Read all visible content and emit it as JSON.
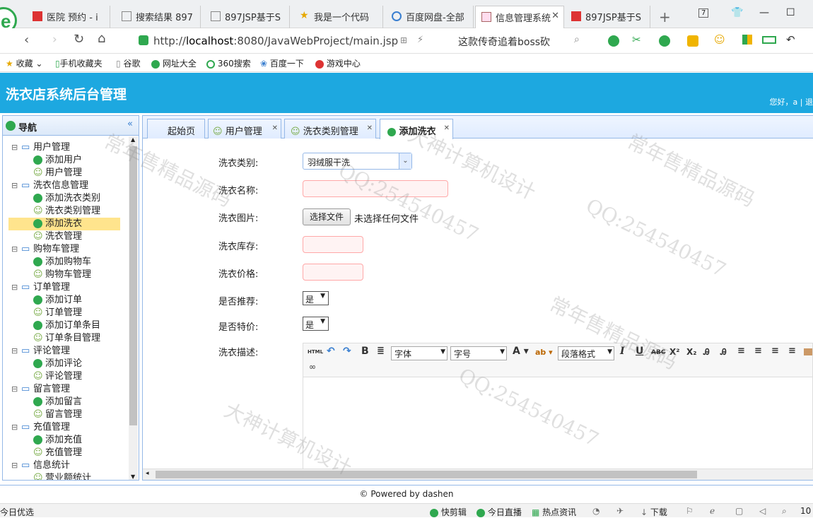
{
  "browser": {
    "tabs": [
      {
        "label": "医院 预约 - i"
      },
      {
        "label": "搜索结果 897"
      },
      {
        "label": "897JSP基于S"
      },
      {
        "label": "我是一个代码"
      },
      {
        "label": "百度网盘-全部"
      },
      {
        "label": "信息管理系统"
      },
      {
        "label": "897JSP基于S"
      }
    ],
    "tab_count": "7",
    "url_prefix": "http://",
    "url_host": "localhost",
    "url_rest": ":8080/JavaWebProject/main.jsp",
    "search_text": "这款传奇追着boss砍",
    "bookmarks": [
      "收藏",
      "手机收藏夹",
      "谷歌",
      "网址大全",
      "360搜索",
      "百度一下",
      "游戏中心"
    ]
  },
  "header": {
    "title": "洗衣店系统后台管理",
    "welcome": "您好，a | 退"
  },
  "sidebar": {
    "title": "导航",
    "collapse_icon": "«",
    "groups": [
      {
        "label": "用户管理",
        "items": [
          "添加用户",
          "用户管理"
        ]
      },
      {
        "label": "洗衣信息管理",
        "items": [
          "添加洗衣类别",
          "洗衣类别管理",
          "添加洗衣",
          "洗衣管理"
        ]
      },
      {
        "label": "购物车管理",
        "items": [
          "添加购物车",
          "购物车管理"
        ]
      },
      {
        "label": "订单管理",
        "items": [
          "添加订单",
          "订单管理",
          "添加订单条目",
          "订单条目管理"
        ]
      },
      {
        "label": "评论管理",
        "items": [
          "添加评论",
          "评论管理"
        ]
      },
      {
        "label": "留言管理",
        "items": [
          "添加留言",
          "留言管理"
        ]
      },
      {
        "label": "充值管理",
        "items": [
          "添加充值",
          "充值管理"
        ]
      },
      {
        "label": "信息统计",
        "items": [
          "营业额统计"
        ]
      }
    ]
  },
  "tabs": [
    {
      "label": "起始页"
    },
    {
      "label": "用户管理"
    },
    {
      "label": "洗衣类别管理"
    },
    {
      "label": "添加洗衣"
    }
  ],
  "form": {
    "category_label": "洗衣类别:",
    "category_value": "羽绒服干洗",
    "name_label": "洗衣名称:",
    "image_label": "洗衣图片:",
    "file_button": "选择文件",
    "file_status": "未选择任何文件",
    "stock_label": "洗衣库存:",
    "price_label": "洗衣价格:",
    "recommend_label": "是否推荐:",
    "recommend_value": "是",
    "special_label": "是否特价:",
    "special_value": "是",
    "desc_label": "洗衣描述:"
  },
  "editor": {
    "html_btn": "HTML",
    "font_family": "字体",
    "font_size": "字号",
    "paragraph": "段落格式",
    "bold": "B",
    "italic": "I",
    "underline": "U",
    "strike": "ABC",
    "sup": "X²",
    "sub": "X₂",
    "font_color": "A",
    "highlight": "ab"
  },
  "footer": {
    "text": "© Powered by dashen"
  },
  "statusbar": {
    "left": "今日优选",
    "items": [
      "快剪辑",
      "今日直播",
      "热点资讯",
      "下载"
    ],
    "zoom": "10"
  },
  "watermarks": [
    "常年售精品源码",
    "QQ:254540457",
    "大神计算机设计",
    "QQ:254540457",
    "常年售精品源码",
    "大神计算机设计",
    "QQ:254540457",
    "常年售精品源码"
  ],
  "colors": {
    "header_bg": "#1da8e0",
    "panel_border": "#95b8e7",
    "selected_item": "#ffe48d",
    "invalid_input_border": "#ffa8a8"
  }
}
